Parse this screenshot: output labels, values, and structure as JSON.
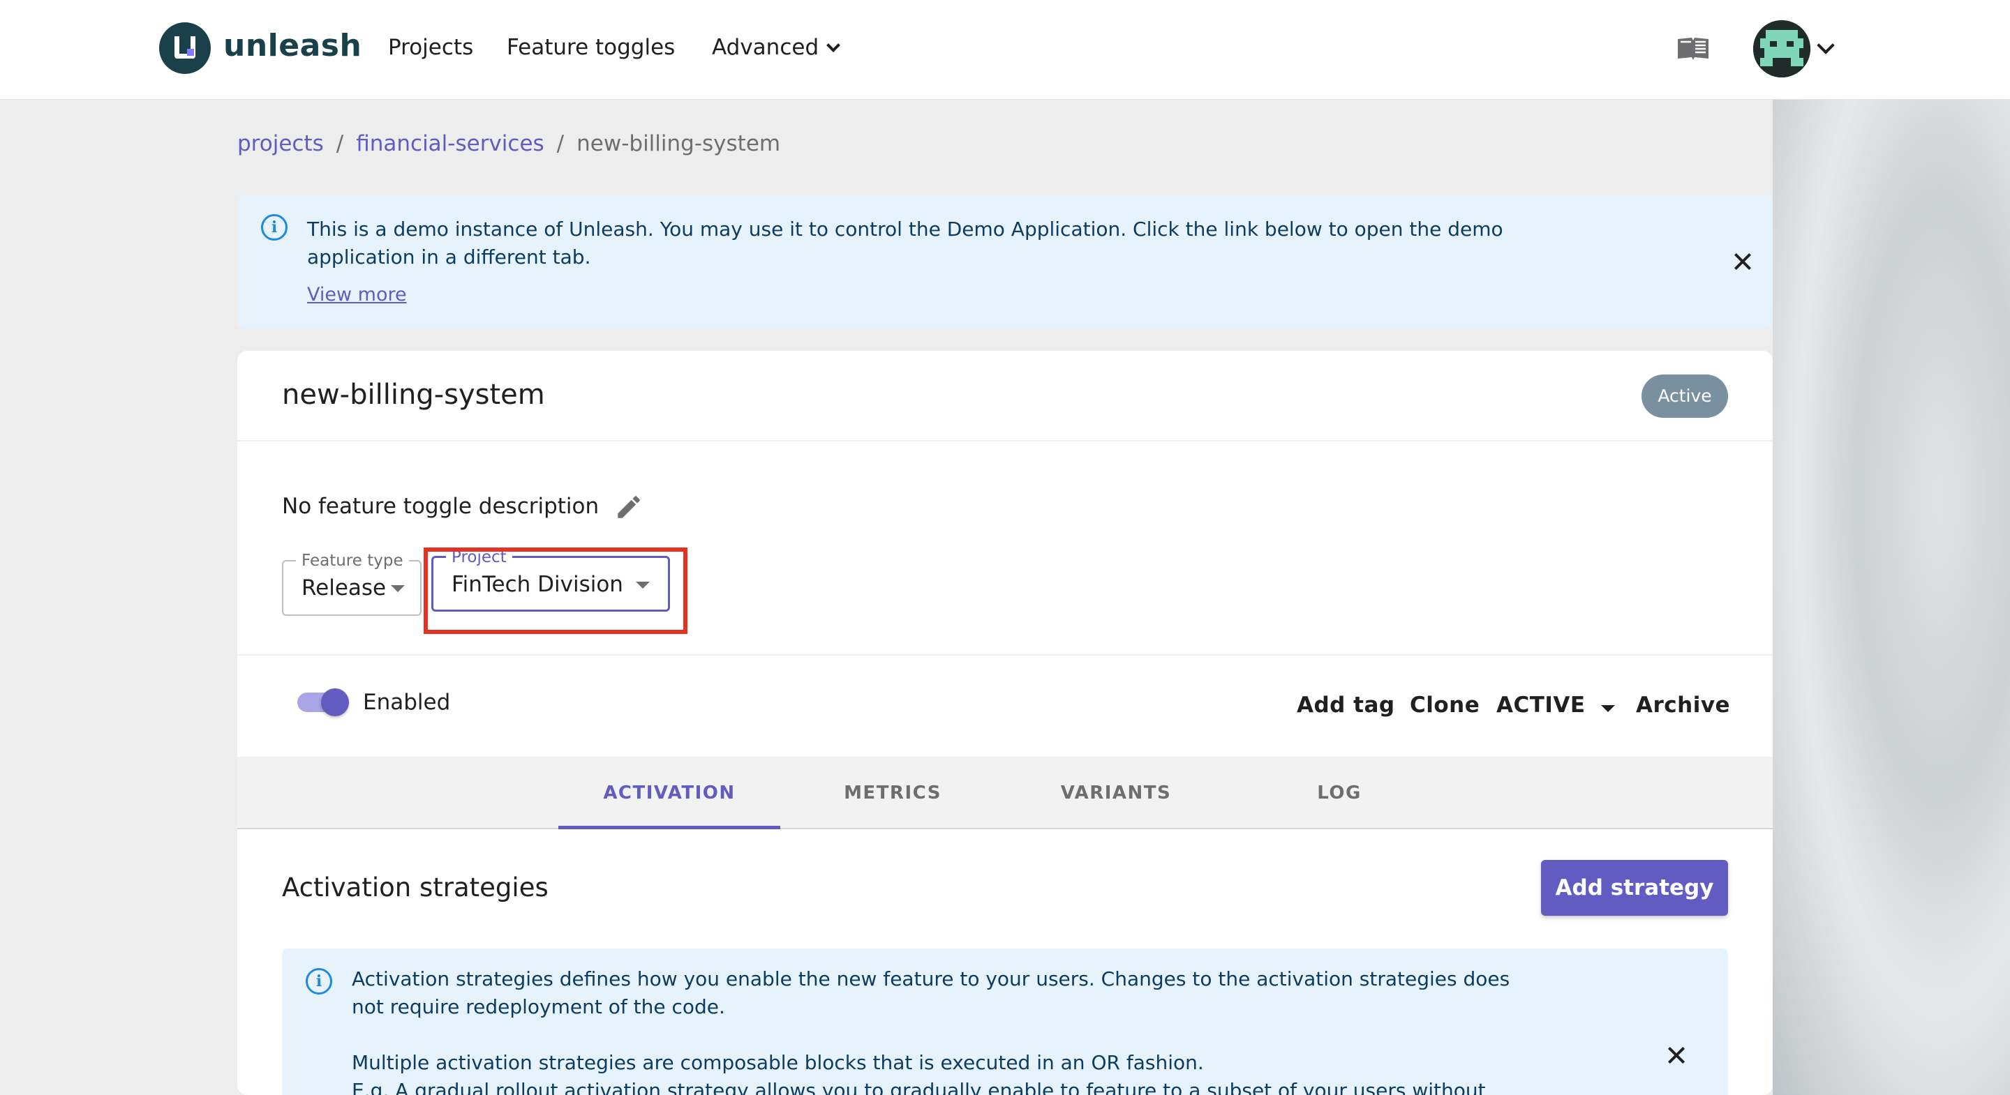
{
  "nav": {
    "logo_text": "unleash",
    "items": [
      "Projects",
      "Feature toggles",
      "Advanced"
    ]
  },
  "breadcrumb": {
    "items": [
      "projects",
      "financial-services",
      "new-billing-system"
    ]
  },
  "demo_banner": {
    "text": "This is a demo instance of Unleash. You may use it to control the Demo Application. Click the link below to open the demo application in a different tab.",
    "link": "View more"
  },
  "feature": {
    "name": "new-billing-system",
    "status": "Active",
    "description": "No feature toggle description",
    "feature_type": {
      "label": "Feature type",
      "value": "Release"
    },
    "project": {
      "label": "Project",
      "value": "FinTech Division"
    },
    "enabled_label": "Enabled",
    "actions": {
      "add_tag": "Add tag",
      "clone": "Clone",
      "state": "ACTIVE",
      "archive": "Archive"
    }
  },
  "tabs": [
    "ACTIVATION",
    "METRICS",
    "VARIANTS",
    "LOG"
  ],
  "activation": {
    "title": "Activation strategies",
    "add_button": "Add strategy",
    "info_p1": "Activation strategies defines how you enable the new feature to your users. Changes to the activation strategies does not require redeployment of the code.",
    "info_p2": "Multiple activation strategies are composable blocks that is executed in an OR fashion.",
    "info_p3": "E.g. A gradual rollout activation strategy allows you to gradually enable to feature to a subset of your users without"
  },
  "colors": {
    "accent": "#615bc2",
    "status_chip": "#7890a0",
    "highlight": "#e53222",
    "info_bg": "#e7f3fc"
  }
}
